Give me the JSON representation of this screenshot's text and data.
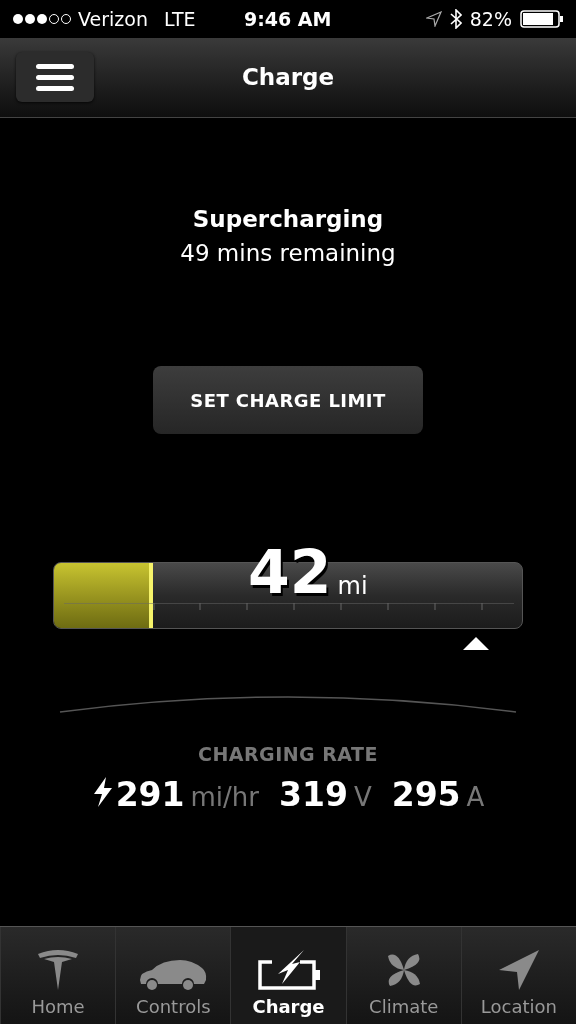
{
  "status_bar": {
    "carrier": "Verizon",
    "network": "LTE",
    "time": "9:46 AM",
    "battery": "82%"
  },
  "nav": {
    "title": "Charge"
  },
  "charge_status": {
    "title": "Supercharging",
    "subtitle": "49 mins remaining"
  },
  "set_limit_button": "SET CHARGE LIMIT",
  "battery_bar": {
    "level": 0.21,
    "range": "42",
    "unit": "mi"
  },
  "charging_rate": {
    "label": "CHARGING RATE",
    "values": [
      {
        "value": "291",
        "unit": "mi/hr"
      },
      {
        "value": "319",
        "unit": "V"
      },
      {
        "value": "295",
        "unit": "A"
      }
    ]
  },
  "tabs": [
    {
      "kind": "home",
      "label": "Home",
      "selected": false
    },
    {
      "kind": "controls",
      "label": "Controls",
      "selected": false
    },
    {
      "kind": "charge",
      "label": "Charge",
      "selected": true
    },
    {
      "kind": "climate",
      "label": "Climate",
      "selected": false
    },
    {
      "kind": "location",
      "label": "Location",
      "selected": false
    }
  ]
}
